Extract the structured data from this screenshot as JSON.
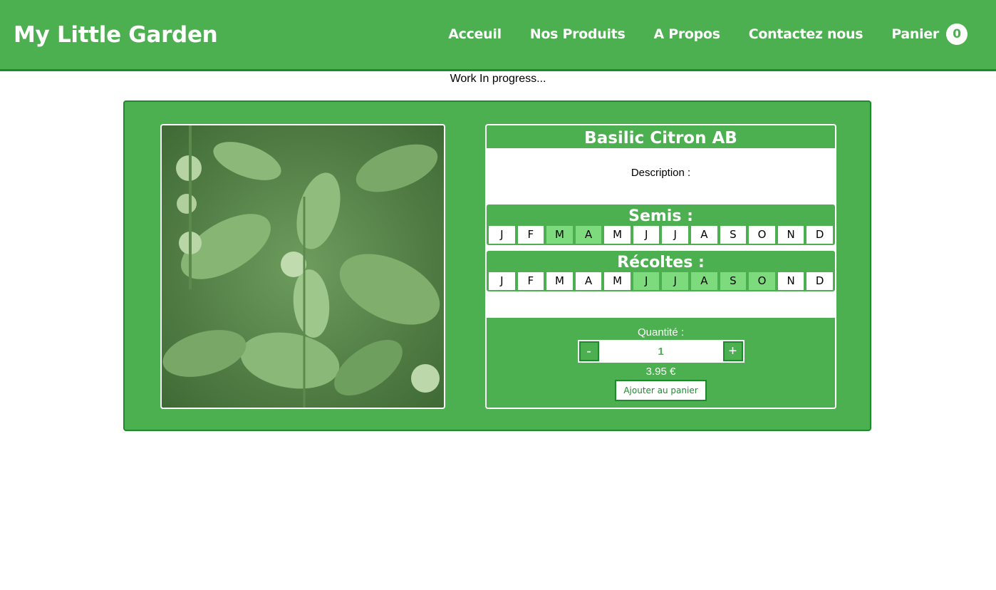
{
  "brand": "My Little Garden",
  "nav": {
    "items": [
      "Acceuil",
      "Nos Produits",
      "A Propos",
      "Contactez nous"
    ],
    "cart_label": "Panier",
    "cart_count": "0"
  },
  "notice": "Work In progress...",
  "product": {
    "name": "Basilic Citron AB",
    "description_label": "Description :",
    "semis_title": "Semis :",
    "recoltes_title": "Récoltes :",
    "months": [
      "J",
      "F",
      "M",
      "A",
      "M",
      "J",
      "J",
      "A",
      "S",
      "O",
      "N",
      "D"
    ],
    "semis_active": [
      false,
      false,
      true,
      true,
      false,
      false,
      false,
      false,
      false,
      false,
      false,
      false
    ],
    "recoltes_active": [
      false,
      false,
      false,
      false,
      false,
      true,
      true,
      true,
      true,
      true,
      false,
      false
    ],
    "quantity_label": "Quantité :",
    "quantity": "1",
    "minus": "-",
    "plus": "+",
    "price": "3.95 €",
    "add_to_cart": "Ajouter au panier"
  },
  "colors": {
    "primary": "#4caf50",
    "dark": "#1e8a2e",
    "month_active": "#7ddb7d"
  }
}
